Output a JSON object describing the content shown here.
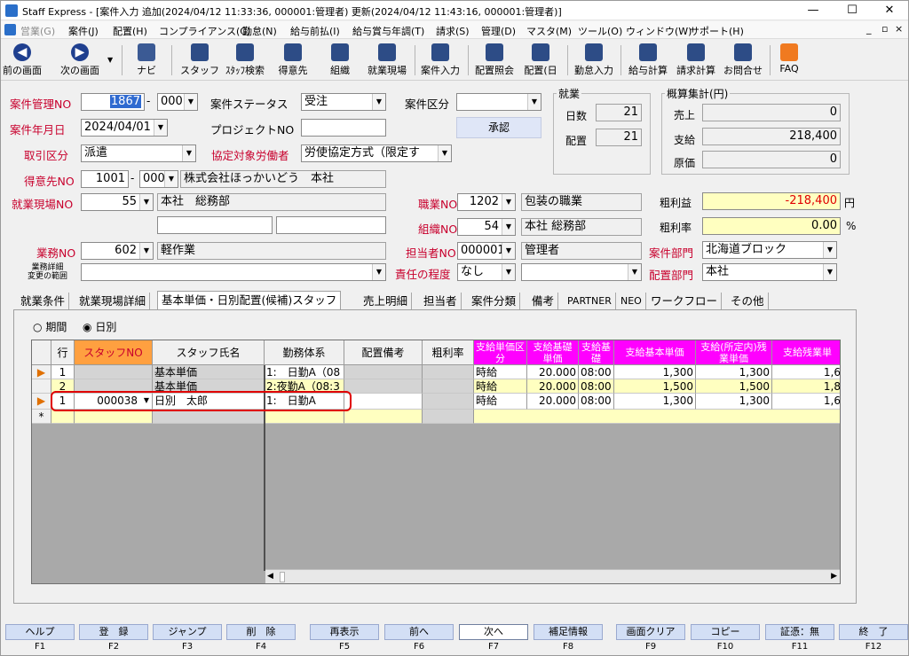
{
  "title": "Staff Express - [案件入力 追加(2024/04/12 11:33:36, 000001:管理者) 更新(2024/04/12 11:43:16, 000001:管理者)]",
  "window_controls": {
    "minimize": "—",
    "restore": "☐",
    "close": "✕"
  },
  "mdi_controls": {
    "minimize": "_",
    "restore": "▫",
    "close": "×"
  },
  "menu": [
    "営業(G)",
    "案件(J)",
    "配置(H)",
    "コンプライアンス(C)",
    "勤怠(N)",
    "給与前払(I)",
    "給与賞与年調(T)",
    "請求(S)",
    "管理(D)",
    "マスタ(M)",
    "ツール(O)",
    "ウィンドウ(W)",
    "サポート(H)"
  ],
  "toolbar": {
    "prev": "前の画面",
    "next": "次の画面",
    "navi": "ナビ",
    "items": [
      "スタッフ",
      "ｽﾀｯﾌ検索",
      "得意先",
      "組織",
      "就業現場",
      "案件入力",
      "配置照会",
      "配置(日",
      "勤怠入力",
      "給与計算",
      "請求計算",
      "お問合せ",
      "FAQ"
    ]
  },
  "form": {
    "case_mgmt_no": {
      "label": "案件管理NO",
      "value": "1867",
      "sub": "000"
    },
    "case_status": {
      "label": "案件ステータス",
      "value": "受注"
    },
    "case_category": {
      "label": "案件区分",
      "value": ""
    },
    "case_date": {
      "label": "案件年月日",
      "value": "2024/04/01"
    },
    "project_no": {
      "label": "プロジェクトNO",
      "value": ""
    },
    "approve_button": "承認",
    "trade_type": {
      "label": "取引区分",
      "value": "派遣"
    },
    "agreement_target": {
      "label": "協定対象労働者",
      "value": "労使協定方式（限定す"
    },
    "client": {
      "label": "得意先NO",
      "no": "1001",
      "sub": "000",
      "name": "株式会社ほっかいどう　本社"
    },
    "worksite": {
      "label": "就業現場NO",
      "no": "55",
      "name": "本社　総務部"
    },
    "job": {
      "label": "職業NO",
      "no": "1202",
      "name": "包装の職業"
    },
    "org": {
      "label": "組織NO",
      "no": "54",
      "name": "本社 総務部"
    },
    "business": {
      "label": "業務NO",
      "no": "602",
      "name": "軽作業"
    },
    "person_in_charge": {
      "label": "担当者NO",
      "no": "000001",
      "name": "管理者"
    },
    "biz_detail": {
      "label1": "業務詳細",
      "label2": "変更の範囲",
      "value": ""
    },
    "responsibility": {
      "label": "責任の程度",
      "value": "なし",
      "value2": ""
    },
    "case_dept": {
      "label": "案件部門",
      "value": "北海道ブロック"
    },
    "place_dept": {
      "label": "配置部門",
      "value": "本社"
    },
    "gross_profit": {
      "label": "粗利益",
      "value": "-218,400",
      "unit": "円"
    },
    "gross_rate": {
      "label": "粗利率",
      "value": "0.00",
      "unit": "%"
    }
  },
  "employment": {
    "title": "就業",
    "days_label": "日数",
    "days": "21",
    "place_label": "配置",
    "place": "21"
  },
  "estimate": {
    "title": "概算集計(円)",
    "sales_label": "売上",
    "sales": "0",
    "pay_label": "支給",
    "pay": "218,400",
    "cost_label": "原価",
    "cost": "0"
  },
  "tabs": [
    "就業条件",
    "就業現場詳細",
    "基本単価・日別配置(候補)スタッフ",
    "売上明細",
    "担当者",
    "案件分類",
    "備考",
    "PARTNER",
    "NEO",
    "ワークフロー",
    "その他"
  ],
  "active_tab": 2,
  "period_radio": {
    "period": "期間",
    "daily": "日別"
  },
  "grid": {
    "headers": [
      "行",
      "スタッフNO",
      "スタッフ氏名",
      "勤務体系",
      "配置備考",
      "粗利率",
      "支給単価区分",
      "支給基礎単価",
      "支給基礎",
      "支給基本単価",
      "支給(所定内)残業単価",
      "支給残業単"
    ],
    "rows": [
      {
        "row": "1",
        "staff_no": "",
        "name": "基本単価",
        "shift": "1:　日勤A（08",
        "note": "",
        "rate": "",
        "unit": "時給",
        "base": "20.000",
        "base2": "08:00",
        "basic": "1,300",
        "ot1": "1,300",
        "ot2": "1,6"
      },
      {
        "row": "2",
        "staff_no": "",
        "name": "基本単価",
        "shift": "2:夜勤A（08:3",
        "note": "",
        "rate": "",
        "unit": "時給",
        "base": "20.000",
        "base2": "08:00",
        "basic": "1,500",
        "ot1": "1,500",
        "ot2": "1,8"
      },
      {
        "row": "1",
        "staff_no": "000038",
        "name": "日別　太郎",
        "shift": "1:　日勤A",
        "note": "",
        "rate": "",
        "unit": "時給",
        "base": "20.000",
        "base2": "08:00",
        "basic": "1,300",
        "ot1": "1,300",
        "ot2": "1,6"
      }
    ],
    "new_row_marker": "*"
  },
  "fkeys": [
    {
      "label": "ヘルプ",
      "key": "F1"
    },
    {
      "label": "登　録",
      "key": "F2"
    },
    {
      "label": "ジャンプ",
      "key": "F3"
    },
    {
      "label": "削　除",
      "key": "F4"
    },
    {
      "label": "再表示",
      "key": "F5"
    },
    {
      "label": "前へ",
      "key": "F6"
    },
    {
      "label": "次へ",
      "key": "F7"
    },
    {
      "label": "補足情報",
      "key": "F8"
    },
    {
      "label": "画面クリア",
      "key": "F9"
    },
    {
      "label": "コピー",
      "key": "F10"
    },
    {
      "label": "証憑：無",
      "key": "F11"
    },
    {
      "label": "終　了",
      "key": "F12"
    }
  ],
  "colors": {
    "red_label": "#c8002d",
    "highlight": "#e00000",
    "orange_header": "#ffa040",
    "magenta_header": "#ff00ff",
    "yellow_row": "#ffffc0"
  }
}
